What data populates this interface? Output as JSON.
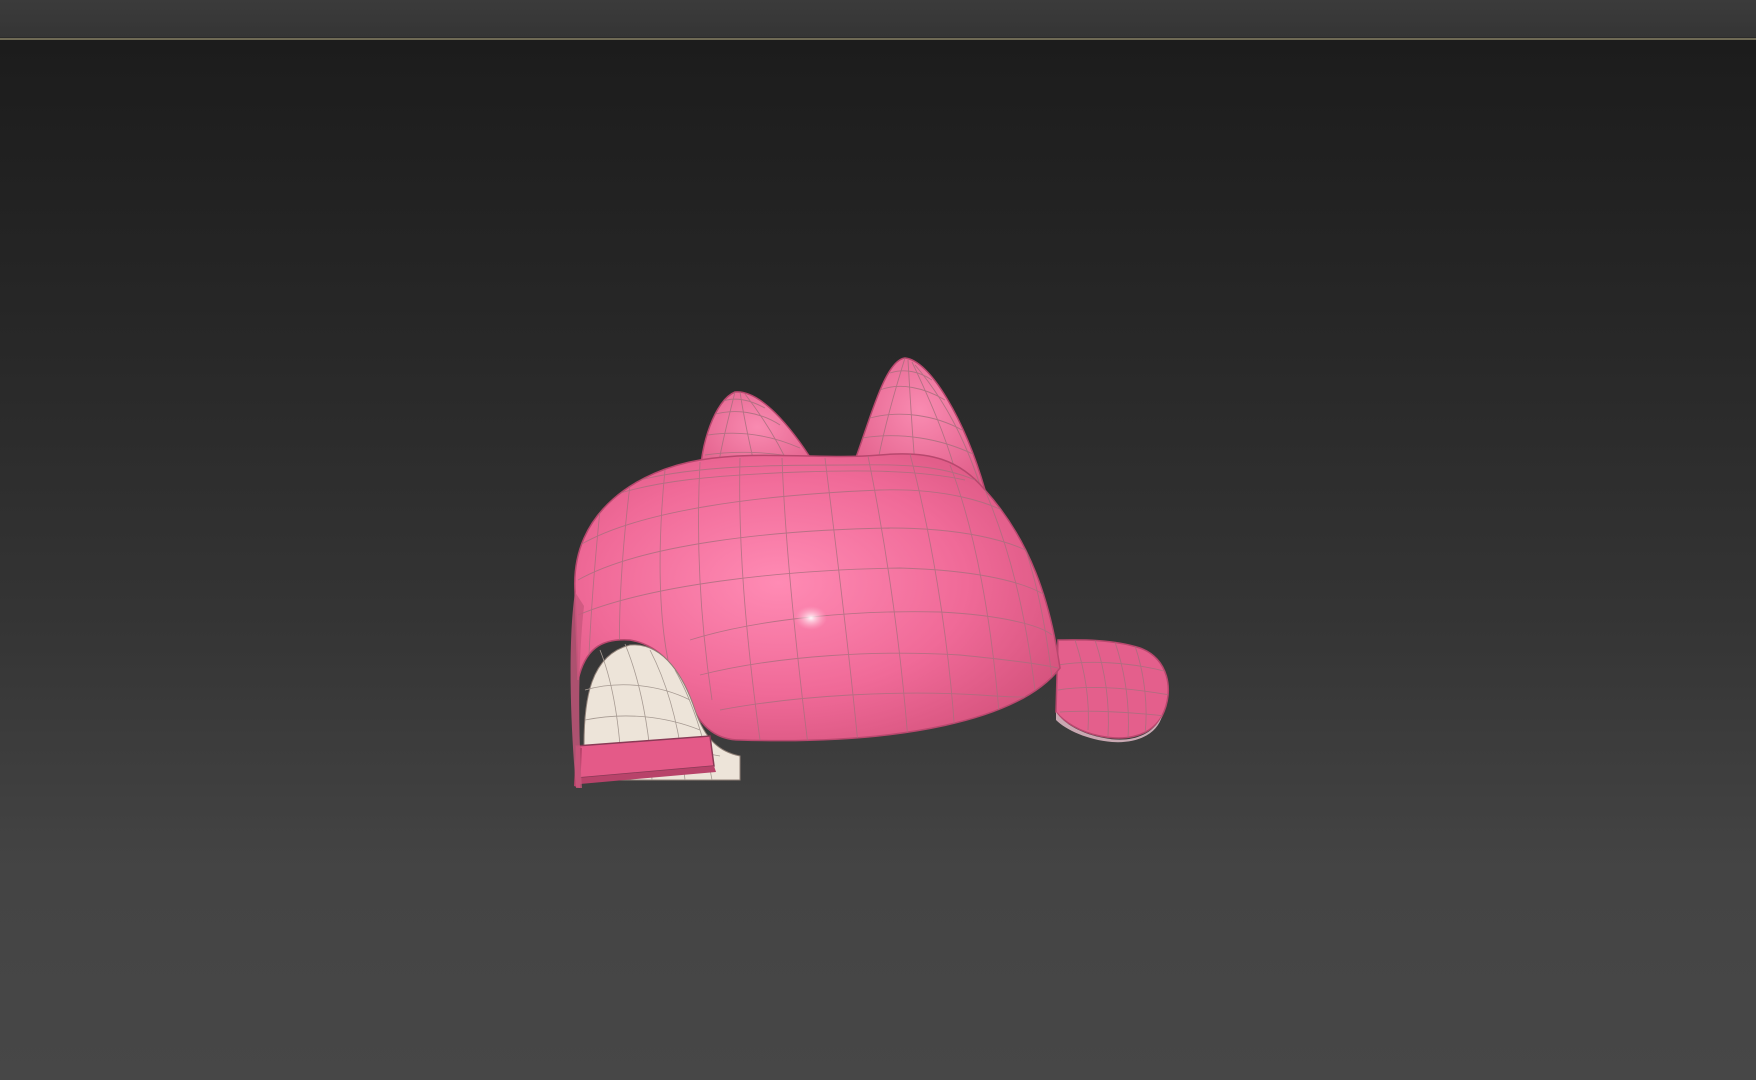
{
  "colors": {
    "viewport_top": "#1c1c1c",
    "viewport_bottom": "#474747",
    "title_bar": "#383838",
    "viewport_border": "#6f6a55",
    "cap_pink": "#f06a98",
    "cap_pink_dark": "#d9557f",
    "cap_inner": "#ece3d8",
    "wire": "#9a7078"
  },
  "icons": {
    "model": "cat-ear-cap-model"
  }
}
